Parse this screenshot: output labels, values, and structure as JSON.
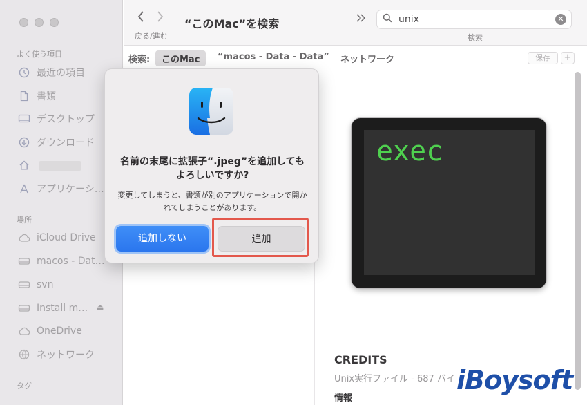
{
  "sidebar": {
    "favorites_header": "よく使う項目",
    "favorites": [
      {
        "label": "最近の項目",
        "icon": "clock-icon"
      },
      {
        "label": "書類",
        "icon": "document-icon"
      },
      {
        "label": "デスクトップ",
        "icon": "desktop-icon"
      },
      {
        "label": "ダウンロード",
        "icon": "download-icon"
      },
      {
        "label": "",
        "icon": "home-icon"
      },
      {
        "label": "アプリケーシ…",
        "icon": "applications-icon"
      }
    ],
    "locations_header": "場所",
    "locations": [
      {
        "label": "iCloud Drive",
        "icon": "cloud-icon"
      },
      {
        "label": "macos - Dat…",
        "icon": "drive-icon"
      },
      {
        "label": "svn",
        "icon": "drive-icon"
      },
      {
        "label": "Install m…",
        "icon": "drive-icon"
      },
      {
        "label": "OneDrive",
        "icon": "cloud-icon"
      },
      {
        "label": "ネットワーク",
        "icon": "network-icon"
      }
    ],
    "tags_header": "タグ"
  },
  "toolbar": {
    "nav_label": "戻る/進む",
    "window_title": "“このMac”を検索",
    "search_value": "unix",
    "search_label": "検索"
  },
  "scopebar": {
    "label": "検索:",
    "scopes": [
      "このMac",
      "“macos - Data - Data”",
      "ネットワーク"
    ],
    "save": "保存",
    "plus": "+"
  },
  "preview": {
    "icon_text": "exec",
    "title": "CREDITS",
    "subtitle": "Unix実行ファイル - 687 バイ",
    "info_header": "情報"
  },
  "dialog": {
    "title": "名前の末尾に拡張子“.jpeg”を追加してもよろしいですか?",
    "message": "変更してしまうと、書類が別のアプリケーションで開かれてしまうことがあります。",
    "cancel_label": "追加しない",
    "confirm_label": "追加"
  },
  "watermark": "iBoysoft",
  "colors": {
    "accent": "#2b76ee",
    "highlight": "#e3584c",
    "terminal_green": "#4fd04f"
  }
}
